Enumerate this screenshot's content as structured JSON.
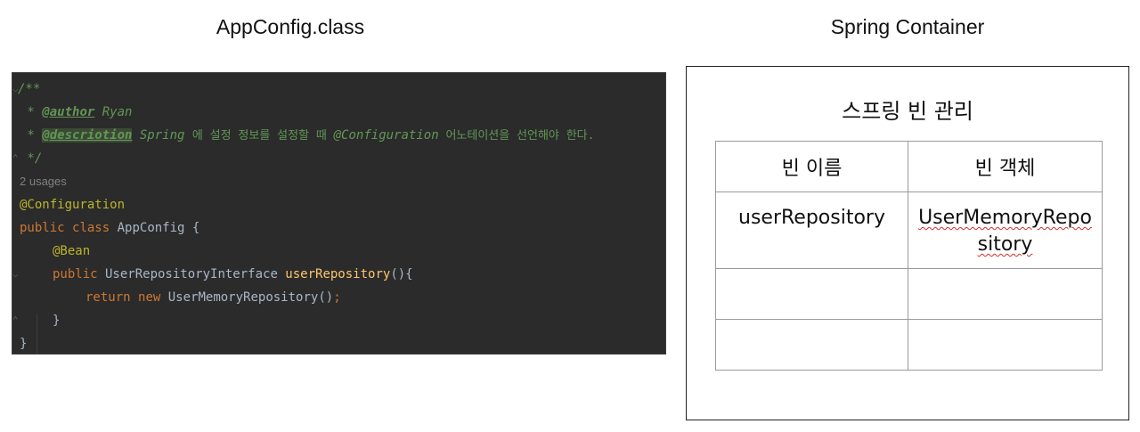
{
  "headings": {
    "left": "AppConfig.class",
    "right": "Spring Container"
  },
  "code": {
    "doc_open": "/**",
    "doc_author_prefix": " * ",
    "doc_author_tag": "@author",
    "doc_author_value": " Ryan",
    "doc_desc_prefix": " * ",
    "doc_desc_tag": "@descriotion",
    "doc_desc_word1": " Spring ",
    "doc_desc_kor1": "에 설정 정보를 설정할 때 ",
    "doc_desc_ann": "@Configuration",
    "doc_desc_kor2": " 어노테이션을 선언해야 한다.",
    "doc_close": " */",
    "usages": "2 usages",
    "annotation_config": "@Configuration",
    "kw_public": "public",
    "kw_class": "class",
    "class_name": " AppConfig {",
    "annotation_bean": "@Bean",
    "method_kw_public": "public",
    "method_return_type": " UserRepositoryInterface ",
    "method_name": "userRepository",
    "method_parens": "(){",
    "kw_return": "return",
    "kw_new": "new",
    "new_expr": " UserMemoryRepository()",
    "semicolon": ";",
    "method_close": "}",
    "class_close": "}"
  },
  "container": {
    "title": "스프링 빈 관리",
    "table": {
      "headers": [
        "빈 이름",
        "빈 객체"
      ],
      "rows": [
        [
          "userRepository",
          "UserMemoryRepository"
        ],
        [
          "",
          ""
        ],
        [
          "",
          ""
        ]
      ],
      "row1_name": "userRepository",
      "row1_object": "UserMemoryRepository"
    }
  },
  "colors": {
    "editor_bg": "#2b2b2b",
    "javadoc": "#629755",
    "keyword": "#cc7832",
    "annotation": "#bbb529",
    "method": "#ffc66d",
    "plain": "#a9b7c6"
  }
}
